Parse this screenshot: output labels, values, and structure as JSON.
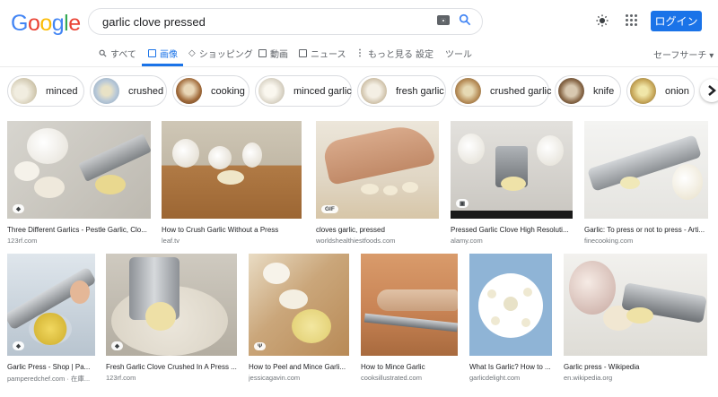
{
  "logo": {
    "letters": [
      "G",
      "o",
      "o",
      "g",
      "l",
      "e"
    ],
    "colors": [
      "#4285F4",
      "#EA4335",
      "#FBBC05",
      "#4285F4",
      "#34A853",
      "#EA4335"
    ]
  },
  "search": {
    "query": "garlic clove pressed"
  },
  "header": {
    "login_label": "ログイン"
  },
  "tabs": [
    {
      "label": "すべて"
    },
    {
      "label": "画像"
    },
    {
      "label": "ショッピング"
    },
    {
      "label": "動画"
    },
    {
      "label": "ニュース"
    },
    {
      "label": "もっと見る"
    },
    {
      "label": "設定"
    },
    {
      "label": "ツール"
    }
  ],
  "safesearch": "セーフサーチ",
  "chips": [
    {
      "label": "minced"
    },
    {
      "label": "crushed"
    },
    {
      "label": "cooking"
    },
    {
      "label": "minced garlic"
    },
    {
      "label": "fresh garlic"
    },
    {
      "label": "crushed garlic"
    },
    {
      "label": "knife"
    },
    {
      "label": "onion"
    }
  ],
  "results": [
    {
      "caption": "Three Different Garlics - Pestle Garlic, Clo...",
      "source": "123rf.com",
      "badge": "◆"
    },
    {
      "caption": "How to Crush Garlic Without a Press",
      "source": "leaf.tv",
      "badge": ""
    },
    {
      "caption": "cloves garlic, pressed",
      "source": "worldshealthiestfoods.com",
      "badge": "GIF"
    },
    {
      "caption": "Pressed Garlic Clove High Resoluti...",
      "source": "alamy.com",
      "badge": "▣"
    },
    {
      "caption": "Garlic: To press or not to press - Arti...",
      "source": "finecooking.com",
      "badge": ""
    },
    {
      "caption": "Garlic Press - Shop | Pa...",
      "source": "pamperedchef.com · 在庫...",
      "badge": "◆"
    },
    {
      "caption": "Fresh Garlic Clove Crushed In A Press ...",
      "source": "123rf.com",
      "badge": "◆"
    },
    {
      "caption": "How to Peel and Mince Garli...",
      "source": "jessicagavin.com",
      "badge": "Ψ"
    },
    {
      "caption": "How to Mince Garlic",
      "source": "cooksillustrated.com",
      "badge": ""
    },
    {
      "caption": "What Is Garlic? How to ...",
      "source": "garlicdelight.com",
      "badge": ""
    },
    {
      "caption": "Garlic press - Wikipedia",
      "source": "en.wikipedia.org",
      "badge": ""
    }
  ],
  "colors": {
    "accent": "#1a73e8",
    "muted": "#5f6368"
  }
}
